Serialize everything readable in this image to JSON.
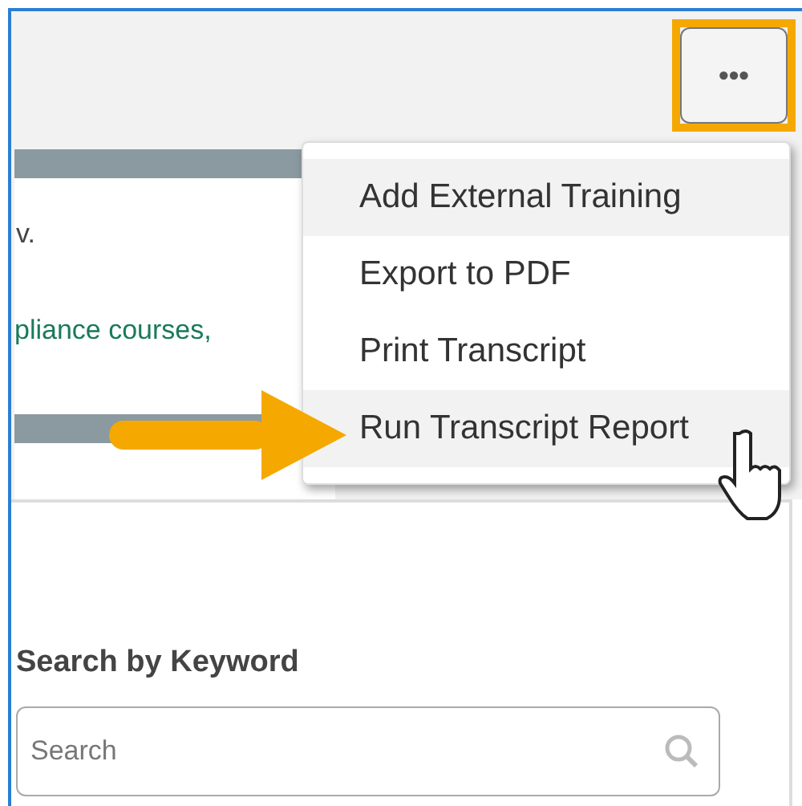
{
  "more_button": {
    "label": "•••",
    "highlighted": true
  },
  "content": {
    "text_1": "v.",
    "link_text": "pliance courses,"
  },
  "menu": {
    "items": [
      {
        "label": "Add External Training",
        "hovered": true
      },
      {
        "label": "Export to PDF",
        "hovered": false
      },
      {
        "label": "Print Transcript",
        "hovered": false
      },
      {
        "label": "Run Transcript Report",
        "hovered": true
      }
    ]
  },
  "search": {
    "heading": "Search by Keyword",
    "placeholder": "Search"
  }
}
